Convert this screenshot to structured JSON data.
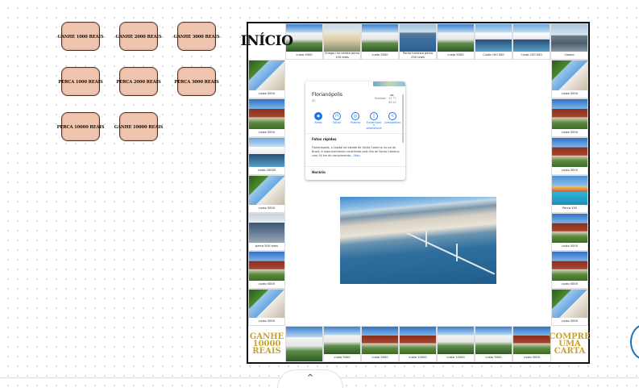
{
  "cards": [
    {
      "label": "GANHE 1000 REAIS"
    },
    {
      "label": "GANHE 2000 REAIS"
    },
    {
      "label": "GANHE 3000 REAIS"
    },
    {
      "label": "PERCA 1000 REAIS"
    },
    {
      "label": "PERCA 2000 REAIS"
    },
    {
      "label": "PERCA 3000 REAIS"
    },
    {
      "label": "PERCA 10000 REAIS"
    },
    {
      "label": "GANHE 10000 REAIS"
    }
  ],
  "board": {
    "start_label": "INÍCIO",
    "bonus_corner": "GANHE 10000 REAIS",
    "buy_card_corner": "COMPRE UMA CARTA",
    "top": [
      "custo 5000",
      "Chegou no centro perca 100 reais",
      "custo 5000",
      "Ponto turístico perca 200 reais",
      "custo 5000",
      "Custo 100 000",
      "Custo 100 000",
      "Casino"
    ],
    "right": [
      "custo 5000",
      "custo 5000",
      "custo 5000",
      "Perca 150",
      "custo 5000",
      "custo 5000",
      "custo 5000"
    ],
    "bottom": [
      "custo 5000",
      "custo 5000",
      "custo 10000",
      "custo 10000",
      "custo 5000",
      "custo 5000"
    ],
    "left": [
      "custo 5000",
      "custo 5000",
      "custo 10000",
      "custo 5000",
      "perca 500 reais",
      "custo 5000",
      "custo 5000"
    ]
  },
  "maps_card": {
    "place_name": "Florianópolis",
    "place_code": "SC",
    "weather": "Nublado · 17 °C",
    "time": "09:22",
    "actions": [
      "Rotas",
      "Salvar",
      "Próximo",
      "Enviar para o smartphone",
      "Compartilhar"
    ],
    "section_title": "Fatos rápidos",
    "description": "Florianópolis, a capital do estado de Santa Catarina no sul do Brasil, é essencialmente constituída pela Ilha de Santa Catarina, com 54 km de comprimento...",
    "more_label": "Mais",
    "hours_label": "Horário"
  },
  "ui": {
    "collapse_icon": "^"
  }
}
